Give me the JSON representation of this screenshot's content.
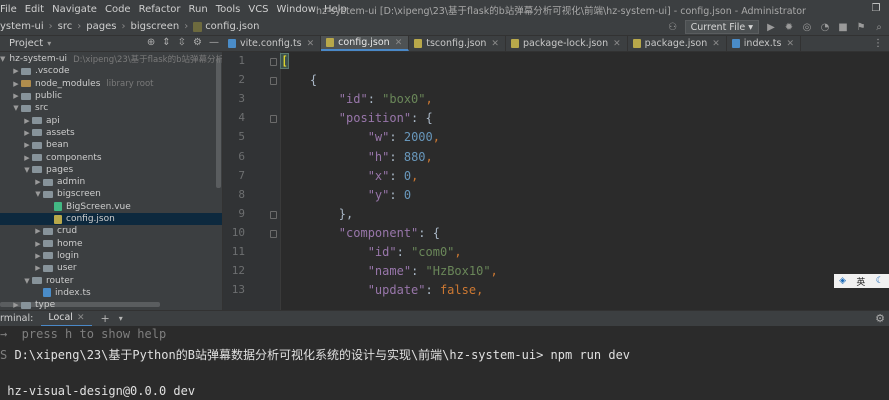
{
  "menubar": {
    "items": [
      "File",
      "Edit",
      "Navigate",
      "Code",
      "Refactor",
      "Run",
      "Tools",
      "VCS",
      "Window",
      "Help"
    ],
    "window_title": "hz-system-ui [D:\\xipeng\\23\\基于flask的b站弹幕分析可视化\\前端\\hz-system-ui] - config.json - Administrator"
  },
  "navbar": {
    "breadcrumbs": [
      "ystem-ui",
      "src",
      "pages",
      "bigscreen",
      "config.json"
    ],
    "run_config": "Current File"
  },
  "project": {
    "title": "Project",
    "tree": [
      {
        "depth": 0,
        "arrow": "down",
        "kind": "folder",
        "label": "hz-system-ui",
        "hint": "D:\\xipeng\\23\\基于flask的b站弹幕分析可视化\\前"
      },
      {
        "depth": 1,
        "arrow": "right",
        "kind": "folder",
        "label": ".vscode"
      },
      {
        "depth": 1,
        "arrow": "right",
        "kind": "excluded",
        "label": "node_modules",
        "hint": "library root"
      },
      {
        "depth": 1,
        "arrow": "right",
        "kind": "folder",
        "label": "public"
      },
      {
        "depth": 1,
        "arrow": "down",
        "kind": "folder",
        "label": "src"
      },
      {
        "depth": 2,
        "arrow": "right",
        "kind": "folder",
        "label": "api"
      },
      {
        "depth": 2,
        "arrow": "right",
        "kind": "folder",
        "label": "assets"
      },
      {
        "depth": 2,
        "arrow": "right",
        "kind": "folder",
        "label": "bean"
      },
      {
        "depth": 2,
        "arrow": "right",
        "kind": "folder",
        "label": "components"
      },
      {
        "depth": 2,
        "arrow": "down",
        "kind": "folder",
        "label": "pages"
      },
      {
        "depth": 3,
        "arrow": "right",
        "kind": "folder",
        "label": "admin"
      },
      {
        "depth": 3,
        "arrow": "down",
        "kind": "folder",
        "label": "bigscreen"
      },
      {
        "depth": 4,
        "arrow": "",
        "kind": "vue",
        "label": "BigScreen.vue"
      },
      {
        "depth": 4,
        "arrow": "",
        "kind": "json",
        "label": "config.json"
      },
      {
        "depth": 3,
        "arrow": "right",
        "kind": "folder",
        "label": "crud"
      },
      {
        "depth": 3,
        "arrow": "right",
        "kind": "folder",
        "label": "home"
      },
      {
        "depth": 3,
        "arrow": "right",
        "kind": "folder",
        "label": "login"
      },
      {
        "depth": 3,
        "arrow": "right",
        "kind": "folder",
        "label": "user"
      },
      {
        "depth": 2,
        "arrow": "down",
        "kind": "folder",
        "label": "router"
      },
      {
        "depth": 3,
        "arrow": "",
        "kind": "ts",
        "label": "index.ts"
      },
      {
        "depth": 1,
        "arrow": "right",
        "kind": "folder",
        "label": "type"
      }
    ]
  },
  "tabs": [
    {
      "label": "vite.config.ts",
      "icon_color": "#4a8cc8",
      "active": false
    },
    {
      "label": "config.json",
      "icon_color": "#b8a84a",
      "active": true
    },
    {
      "label": "tsconfig.json",
      "icon_color": "#b8a84a",
      "active": false
    },
    {
      "label": "package-lock.json",
      "icon_color": "#b8a84a",
      "active": false
    },
    {
      "label": "package.json",
      "icon_color": "#b8a84a",
      "active": false
    },
    {
      "label": "index.ts",
      "icon_color": "#4a8cc8",
      "active": false
    }
  ],
  "editor": {
    "line_numbers": [
      "1",
      "2",
      "3",
      "4",
      "5",
      "6",
      "7",
      "8",
      "9",
      "10",
      "11",
      "12",
      "13"
    ],
    "lines": [
      [
        {
          "t": "[",
          "c": "br-hl"
        }
      ],
      [
        {
          "t": "    {",
          "c": ""
        }
      ],
      [
        {
          "t": "        ",
          "c": ""
        },
        {
          "t": "\"id\"",
          "c": "k"
        },
        {
          "t": ": ",
          "c": ""
        },
        {
          "t": "\"box0\"",
          "c": "s"
        },
        {
          "t": ",",
          "c": "kw"
        }
      ],
      [
        {
          "t": "        ",
          "c": ""
        },
        {
          "t": "\"position\"",
          "c": "k"
        },
        {
          "t": ": {",
          "c": ""
        }
      ],
      [
        {
          "t": "            ",
          "c": ""
        },
        {
          "t": "\"w\"",
          "c": "k"
        },
        {
          "t": ": ",
          "c": ""
        },
        {
          "t": "2000",
          "c": "n"
        },
        {
          "t": ",",
          "c": "kw"
        }
      ],
      [
        {
          "t": "            ",
          "c": ""
        },
        {
          "t": "\"h\"",
          "c": "k"
        },
        {
          "t": ": ",
          "c": ""
        },
        {
          "t": "880",
          "c": "n"
        },
        {
          "t": ",",
          "c": "kw"
        }
      ],
      [
        {
          "t": "            ",
          "c": ""
        },
        {
          "t": "\"x\"",
          "c": "k"
        },
        {
          "t": ": ",
          "c": ""
        },
        {
          "t": "0",
          "c": "n"
        },
        {
          "t": ",",
          "c": "kw"
        }
      ],
      [
        {
          "t": "            ",
          "c": ""
        },
        {
          "t": "\"y\"",
          "c": "k"
        },
        {
          "t": ": ",
          "c": ""
        },
        {
          "t": "0",
          "c": "n"
        }
      ],
      [
        {
          "t": "        },",
          "c": ""
        }
      ],
      [
        {
          "t": "        ",
          "c": ""
        },
        {
          "t": "\"component\"",
          "c": "k"
        },
        {
          "t": ": {",
          "c": ""
        }
      ],
      [
        {
          "t": "            ",
          "c": ""
        },
        {
          "t": "\"id\"",
          "c": "k"
        },
        {
          "t": ": ",
          "c": ""
        },
        {
          "t": "\"com0\"",
          "c": "s"
        },
        {
          "t": ",",
          "c": "kw"
        }
      ],
      [
        {
          "t": "            ",
          "c": ""
        },
        {
          "t": "\"name\"",
          "c": "k"
        },
        {
          "t": ": ",
          "c": ""
        },
        {
          "t": "\"HzBox10\"",
          "c": "s"
        },
        {
          "t": ",",
          "c": "kw"
        }
      ],
      [
        {
          "t": "            ",
          "c": ""
        },
        {
          "t": "\"update\"",
          "c": "k"
        },
        {
          "t": ": ",
          "c": ""
        },
        {
          "t": "false",
          "c": "kw"
        },
        {
          "t": ",",
          "c": "kw"
        }
      ]
    ]
  },
  "ime": {
    "lang": "英"
  },
  "terminal": {
    "title": "rminal:",
    "tab_label": "Local",
    "lines": [
      {
        "prefix": "→",
        "text": "  press h to show help"
      },
      {
        "prefix": "S",
        "text": " D:\\xipeng\\23\\基于Python的B站弹幕数据分析可视化系统的设计与实现\\前端\\hz-system-ui> npm run dev"
      },
      {
        "prefix": "",
        "text": ""
      },
      {
        "prefix": "",
        "text": " hz-visual-design@0.0.0 dev"
      }
    ]
  }
}
